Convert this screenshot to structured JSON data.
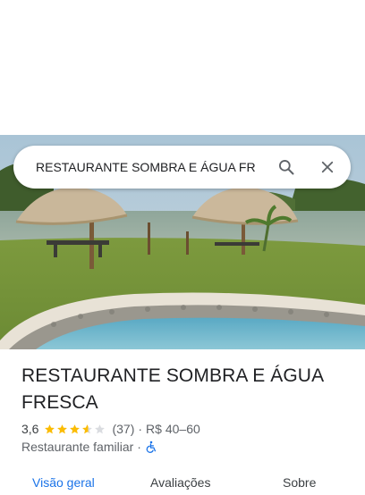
{
  "search": {
    "value": "RESTAURANTE SOMBRA E ÁGUA FR",
    "search_icon": "search-icon",
    "clear_icon": "close-icon"
  },
  "photo": {
    "icon": "place-photo"
  },
  "place": {
    "name": "RESTAURANTE SOMBRA E ÁGUA FRESCA",
    "rating": "3,6",
    "rating_value": 3.6,
    "stars_total": 5,
    "review_count": "(37)",
    "separator": "·",
    "price_range": "R$ 40–60",
    "category": "Restaurante familiar",
    "accessibility_icon": "wheelchair-icon"
  },
  "tabs": [
    {
      "label": "Visão geral",
      "active": true
    },
    {
      "label": "Avaliações",
      "active": false
    },
    {
      "label": "Sobre",
      "active": false
    }
  ],
  "colors": {
    "star": "#fbbc04",
    "star_empty": "#dadce0",
    "accent": "#1a73e8",
    "accessibility": "#1a73e8"
  }
}
